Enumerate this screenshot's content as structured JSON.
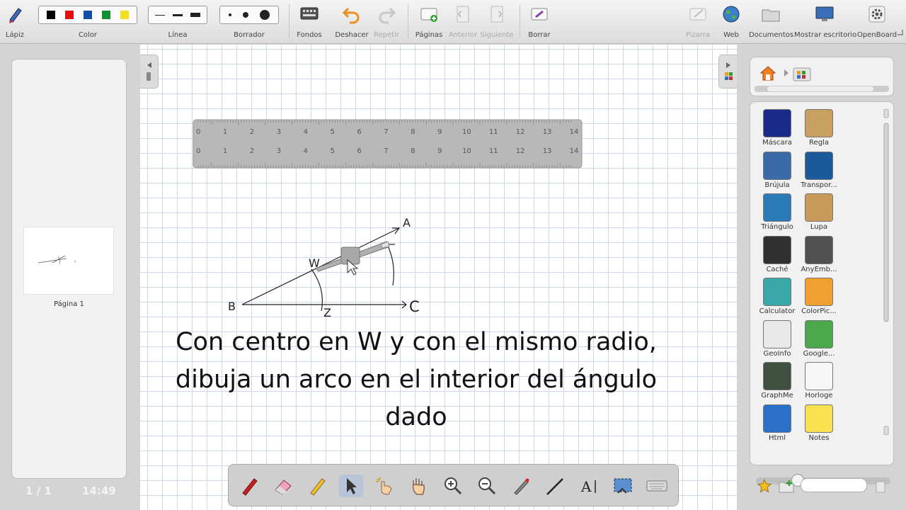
{
  "toolbar": {
    "pen": "Lápiz",
    "color": "Color",
    "line": "Línea",
    "eraser": "Borrador",
    "backgrounds": "Fondos",
    "undo": "Deshacer",
    "redo": "Repetir",
    "pages": "Páginas",
    "previous": "Anterior",
    "next": "Siguiente",
    "clear": "Borrar",
    "board": "Pizarra",
    "web": "Web",
    "documents": "Documentos",
    "show_desktop": "Mostrar escritorio",
    "openboard": "OpenBoard",
    "colors": [
      "#000000",
      "#e01010",
      "#1050a8",
      "#109030",
      "#f0e020"
    ]
  },
  "left_panel": {
    "page_thumb_label": "Página 1",
    "page_counter": "1 / 1",
    "clock": "14:49"
  },
  "ruler": {
    "ticks": [
      "0",
      "1",
      "2",
      "3",
      "4",
      "5",
      "6",
      "7",
      "8",
      "9",
      "10",
      "11",
      "12",
      "13",
      "14"
    ]
  },
  "drawing": {
    "label_a": "A",
    "label_b": "B",
    "label_c": "C",
    "label_w": "W",
    "label_z": "Z"
  },
  "caption": {
    "line1": "Con centro en W y con el mismo radio,",
    "line2": "dibuja un arco en el interior del ángulo",
    "line3": "dado"
  },
  "library": {
    "items": [
      {
        "label": "Máscara",
        "color": "#1a2a8a"
      },
      {
        "label": "Regla",
        "color": "#c8a060"
      },
      {
        "label": "Brújula",
        "color": "#3a6aa8"
      },
      {
        "label": "Transpor...",
        "color": "#1a5a9a"
      },
      {
        "label": "Triángulo",
        "color": "#2a7ab8"
      },
      {
        "label": "Lupa",
        "color": "#c89a5a"
      },
      {
        "label": "Caché",
        "color": "#303030"
      },
      {
        "label": "AnyEmb...",
        "color": "#505050"
      },
      {
        "label": "Calculator",
        "color": "#3aa8a8"
      },
      {
        "label": "ColorPic...",
        "color": "#f0a030"
      },
      {
        "label": "GeoInfo",
        "color": "#e8e8e8"
      },
      {
        "label": "Google...",
        "color": "#4aa84a"
      },
      {
        "label": "GraphMe",
        "color": "#405040"
      },
      {
        "label": "Horloge",
        "color": "#f6f6f6"
      },
      {
        "label": "Html",
        "color": "#2a70c8"
      },
      {
        "label": "Notes",
        "color": "#f8e050"
      }
    ]
  }
}
